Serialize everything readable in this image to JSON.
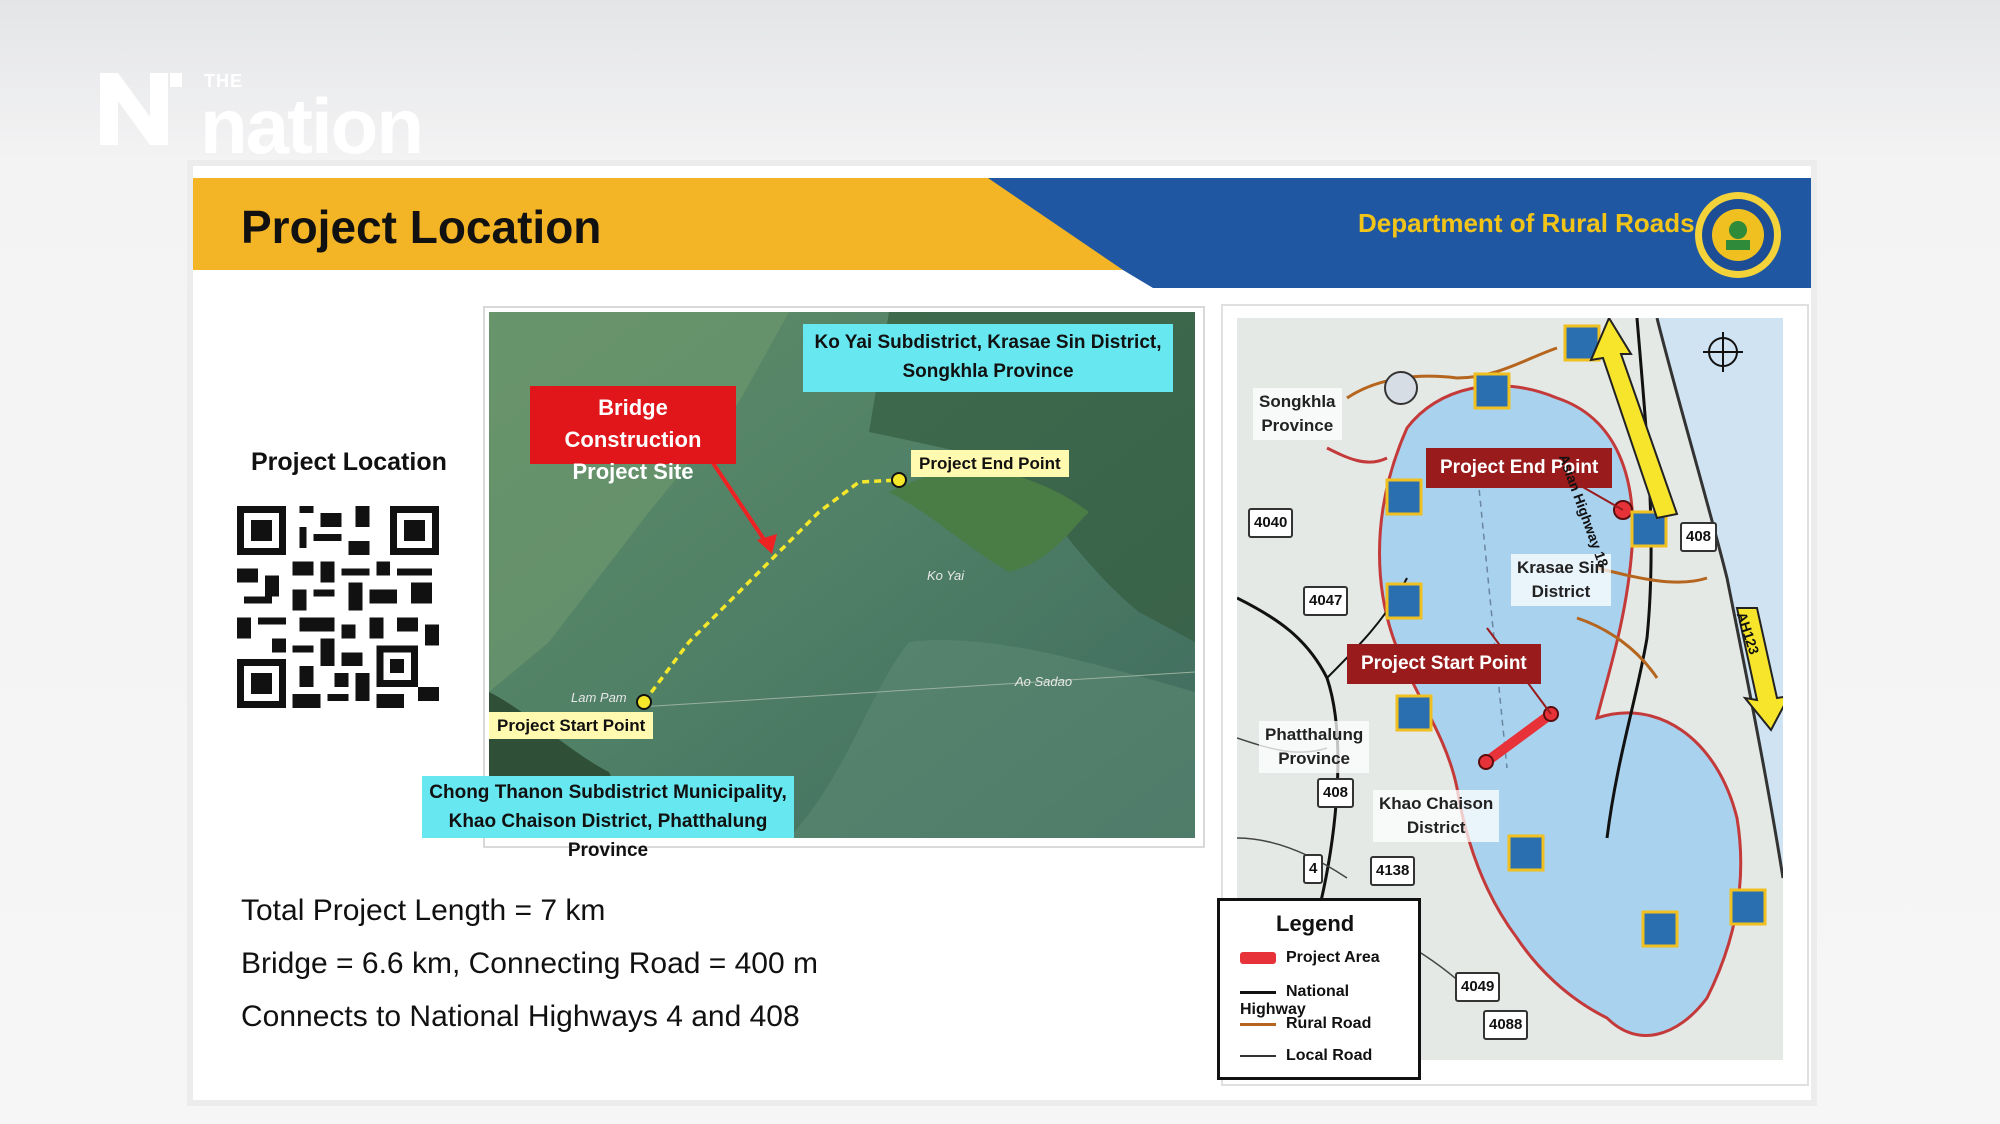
{
  "logo": {
    "prefix": "THE",
    "name": "nation"
  },
  "header": {
    "title": "Project Location",
    "department": "Department of Rural Roads",
    "colors": {
      "yellow": "#f3b426",
      "blue": "#1f57a3",
      "dept_text": "#f2c418"
    }
  },
  "qr": {
    "label": "Project Location"
  },
  "info": {
    "lines": [
      "Total Project Length = 7 km",
      "Bridge = 6.6 km, Connecting Road = 400 m",
      "Connects to National Highways 4 and 408"
    ]
  },
  "satellite": {
    "end_location": "Ko Yai Subdistrict, Krasae Sin District, Songkhla Province",
    "end_location_line1": "Ko Yai Subdistrict, Krasae Sin District,",
    "end_location_line2": "Songkhla Province",
    "site_label_line1": "Bridge Construction",
    "site_label_line2": "Project Site",
    "end_point": "Project End Point",
    "start_point": "Project Start Point",
    "start_location_line1": "Chong Thanon Subdistrict Municipality,",
    "start_location_line2": "Khao Chaison District, Phatthalung Province",
    "place_ko_yai": "Ko Yai",
    "place_lam_pam": "Lam Pam",
    "place_ao_sadao": "Ao Sadao"
  },
  "map": {
    "end_point": "Project End Point",
    "start_point": "Project Start Point",
    "songkhla_line1": "Songkhla",
    "songkhla_line2": "Province",
    "krasae_line1": "Krasae Sin",
    "krasae_line2": "District",
    "phatthalung_line1": "Phatthalung",
    "phatthalung_line2": "Province",
    "khao_line1": "Khao Chaison",
    "khao_line2": "District",
    "asian_highway_18": "Asian Highway 18",
    "ah123": "AH123",
    "routes": [
      "4040",
      "4047",
      "408",
      "408",
      "4",
      "4138",
      "4049",
      "4088"
    ]
  },
  "legend": {
    "title": "Legend",
    "items": [
      {
        "label": "Project Area",
        "color": "#e8323a"
      },
      {
        "label": "National Highway",
        "color": "#111111"
      },
      {
        "label": "Rural Road",
        "color": "#b5651d"
      },
      {
        "label": "Local Road",
        "color": "#333333"
      }
    ]
  }
}
